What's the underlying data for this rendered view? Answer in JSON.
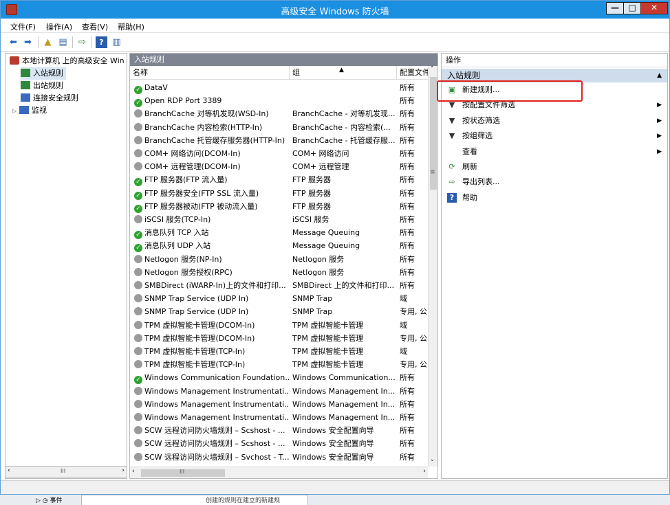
{
  "window": {
    "title": "高级安全 Windows 防火墙",
    "minimize": "—",
    "maximize": "□",
    "close": "✕"
  },
  "menu": [
    "文件(F)",
    "操作(A)",
    "查看(V)",
    "帮助(H)"
  ],
  "tree": {
    "root": "本地计算机 上的高级安全 Win",
    "items": [
      "入站规则",
      "出站规则",
      "连接安全规则",
      "监视"
    ],
    "scroll_glyph": "III"
  },
  "center": {
    "header": "入站规则",
    "columns": [
      "名称",
      "组",
      "配置文件"
    ],
    "rules": [
      {
        "name": "DataV",
        "group": "",
        "profile": "所有",
        "enabled": true
      },
      {
        "name": "Open RDP Port 3389",
        "group": "",
        "profile": "所有",
        "enabled": true
      },
      {
        "name": "BranchCache 对等机发现(WSD-In)",
        "group": "BranchCache - 对等机发现...",
        "profile": "所有",
        "enabled": false
      },
      {
        "name": "BranchCache 内容检索(HTTP-In)",
        "group": "BranchCache - 内容检索(...",
        "profile": "所有",
        "enabled": false
      },
      {
        "name": "BranchCache 托管缓存服务器(HTTP-In)",
        "group": "BranchCache - 托管缓存服...",
        "profile": "所有",
        "enabled": false
      },
      {
        "name": "COM+ 网络访问(DCOM-In)",
        "group": "COM+ 网络访问",
        "profile": "所有",
        "enabled": false
      },
      {
        "name": "COM+ 远程管理(DCOM-In)",
        "group": "COM+ 远程管理",
        "profile": "所有",
        "enabled": false
      },
      {
        "name": "FTP 服务器(FTP 流入量)",
        "group": "FTP 服务器",
        "profile": "所有",
        "enabled": true
      },
      {
        "name": "FTP 服务器安全(FTP SSL 流入量)",
        "group": "FTP 服务器",
        "profile": "所有",
        "enabled": true
      },
      {
        "name": "FTP 服务器被动(FTP 被动流入量)",
        "group": "FTP 服务器",
        "profile": "所有",
        "enabled": true
      },
      {
        "name": "iSCSI 服务(TCP-In)",
        "group": "iSCSI 服务",
        "profile": "所有",
        "enabled": false
      },
      {
        "name": "消息队列 TCP 入站",
        "group": "Message Queuing",
        "profile": "所有",
        "enabled": true
      },
      {
        "name": "消息队列 UDP 入站",
        "group": "Message Queuing",
        "profile": "所有",
        "enabled": true
      },
      {
        "name": "Netlogon 服务(NP-In)",
        "group": "Netlogon 服务",
        "profile": "所有",
        "enabled": false
      },
      {
        "name": "Netlogon 服务授权(RPC)",
        "group": "Netlogon 服务",
        "profile": "所有",
        "enabled": false
      },
      {
        "name": "SMBDirect (iWARP-In)上的文件和打印...",
        "group": "SMBDirect 上的文件和打印...",
        "profile": "所有",
        "enabled": false
      },
      {
        "name": "SNMP Trap Service (UDP In)",
        "group": "SNMP Trap",
        "profile": "域",
        "enabled": false
      },
      {
        "name": "SNMP Trap Service (UDP In)",
        "group": "SNMP Trap",
        "profile": "专用, 公",
        "enabled": false
      },
      {
        "name": "TPM 虚拟智能卡管理(DCOM-In)",
        "group": "TPM 虚拟智能卡管理",
        "profile": "域",
        "enabled": false
      },
      {
        "name": "TPM 虚拟智能卡管理(DCOM-In)",
        "group": "TPM 虚拟智能卡管理",
        "profile": "专用, 公",
        "enabled": false
      },
      {
        "name": "TPM 虚拟智能卡管理(TCP-In)",
        "group": "TPM 虚拟智能卡管理",
        "profile": "域",
        "enabled": false
      },
      {
        "name": "TPM 虚拟智能卡管理(TCP-In)",
        "group": "TPM 虚拟智能卡管理",
        "profile": "专用, 公",
        "enabled": false
      },
      {
        "name": "Windows Communication Foundation...",
        "group": "Windows Communication...",
        "profile": "所有",
        "enabled": true
      },
      {
        "name": "Windows Management Instrumentati...",
        "group": "Windows Management In...",
        "profile": "所有",
        "enabled": false
      },
      {
        "name": "Windows Management Instrumentati...",
        "group": "Windows Management In...",
        "profile": "所有",
        "enabled": false
      },
      {
        "name": "Windows Management Instrumentati...",
        "group": "Windows Management In...",
        "profile": "所有",
        "enabled": false
      },
      {
        "name": "SCW 远程访问防火墙规则 – Scshost - ...",
        "group": "Windows 安全配置向导",
        "profile": "所有",
        "enabled": false
      },
      {
        "name": "SCW 远程访问防火墙规则 – Scshost - ...",
        "group": "Windows 安全配置向导",
        "profile": "所有",
        "enabled": false
      },
      {
        "name": "SCW 远程访问防火墙规则 – Svchost - T...",
        "group": "Windows 安全配置向导",
        "profile": "所有",
        "enabled": false
      }
    ],
    "scroll_glyph": "III",
    "scroll_mid_glyph": "≡"
  },
  "actions": {
    "header": "操作",
    "section": "入站规则",
    "items": [
      {
        "label": "新建规则...",
        "icon": "new-rule-icon",
        "submenu": false
      },
      {
        "label": "按配置文件筛选",
        "icon": "filter-icon",
        "submenu": true
      },
      {
        "label": "按状态筛选",
        "icon": "filter-icon",
        "submenu": true
      },
      {
        "label": "按组筛选",
        "icon": "filter-icon",
        "submenu": true
      },
      {
        "label": "查看",
        "icon": "",
        "submenu": true
      },
      {
        "label": "刷新",
        "icon": "refresh-icon",
        "submenu": false
      },
      {
        "label": "导出列表...",
        "icon": "export-icon",
        "submenu": false
      },
      {
        "label": "帮助",
        "icon": "help-icon",
        "submenu": false
      }
    ]
  },
  "taskbar_peek": {
    "label": "事件",
    "text": "创建的规则在建立的新建规"
  },
  "colors": {
    "titlebar": "#1b8fe0",
    "pane_header": "#7e8491",
    "action_section": "#cfdcec",
    "enabled_rule": "#2ea32e",
    "disabled_rule": "#9a9a9a",
    "highlight": "#e02020"
  }
}
